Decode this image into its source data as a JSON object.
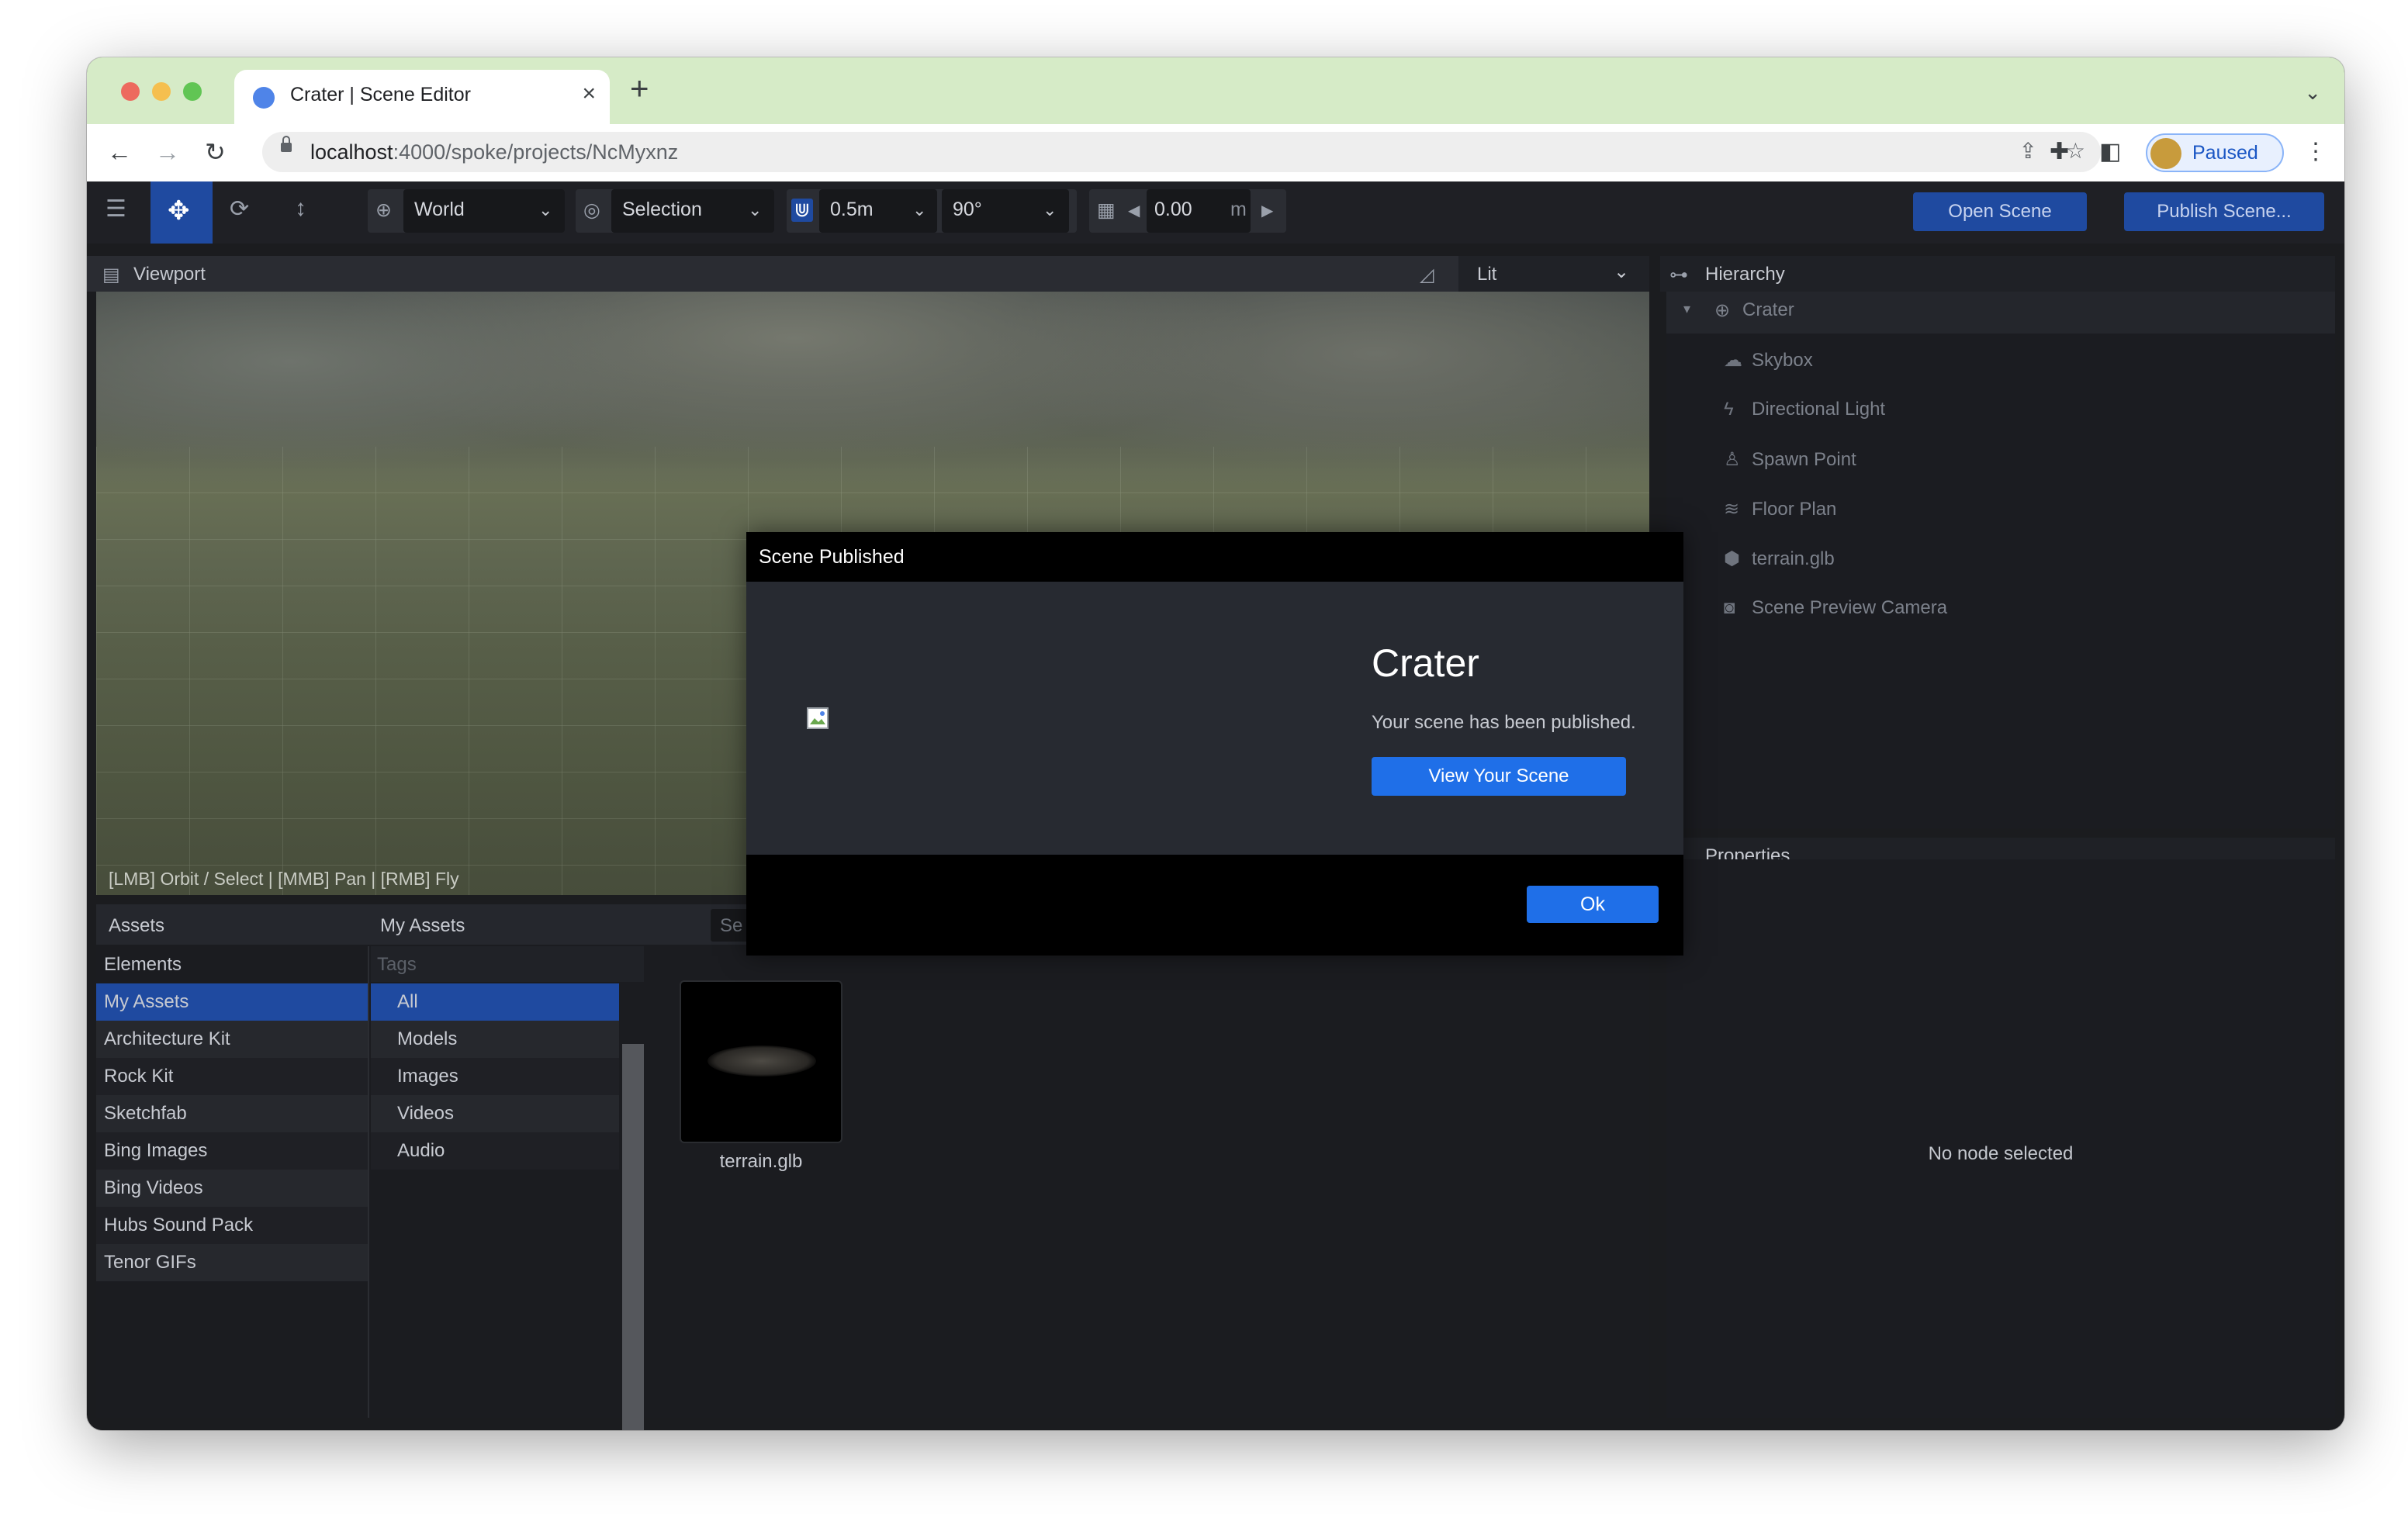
{
  "browser": {
    "tab_title": "Crater | Scene Editor",
    "url_host": "localhost",
    "url_path": ":4000/spoke/projects/NcMyxnz",
    "profile_label": "Paused"
  },
  "toolbar": {
    "space": "World",
    "pivot": "Selection",
    "snap_translate": "0.5m",
    "snap_rotate": "90°",
    "grid_height": "0.00",
    "grid_unit": "m",
    "open_scene": "Open Scene",
    "publish_scene": "Publish Scene..."
  },
  "viewport": {
    "title": "Viewport",
    "render_mode": "Lit",
    "hint": "[LMB] Orbit / Select | [MMB] Pan | [RMB] Fly"
  },
  "hierarchy": {
    "title": "Hierarchy",
    "root": "Crater",
    "items": [
      "Skybox",
      "Directional Light",
      "Spawn Point",
      "Floor Plan",
      "terrain.glb",
      "Scene Preview Camera"
    ]
  },
  "properties": {
    "title": "Properties",
    "empty": "No node selected"
  },
  "assets": {
    "title": "Assets",
    "sub_title": "My Assets",
    "search_placeholder": "Se",
    "tags_placeholder": "Tags",
    "categories": [
      "Elements",
      "My Assets",
      "Architecture Kit",
      "Rock Kit",
      "Sketchfab",
      "Bing Images",
      "Bing Videos",
      "Hubs Sound Pack",
      "Tenor GIFs"
    ],
    "tags": [
      "All",
      "Models",
      "Images",
      "Videos",
      "Audio"
    ],
    "files": [
      "terrain.glb"
    ]
  },
  "modal": {
    "title": "Scene Published",
    "heading": "Crater",
    "message": "Your scene has been published.",
    "view_button": "View Your Scene",
    "ok_button": "Ok"
  },
  "colors": {
    "accent": "#1f6fe8",
    "tab_strip": "#d6ebc7",
    "selected_item": "#1f4aa0"
  }
}
